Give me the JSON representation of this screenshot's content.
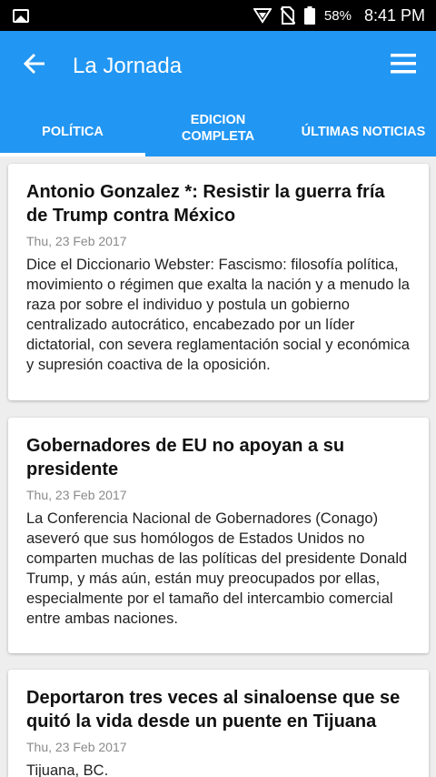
{
  "status_bar": {
    "battery_percent": "58%",
    "time": "8:41 PM"
  },
  "app_bar": {
    "title": "La Jornada",
    "back_icon": "arrow-left-icon",
    "menu_icon": "hamburger-menu-icon"
  },
  "tabs": [
    {
      "line1": "POLÍTICA",
      "line2": ""
    },
    {
      "line1": "EDICION",
      "line2": "COMPLETA"
    },
    {
      "line1": "ÚLTIMAS NOTICIAS",
      "line2": ""
    }
  ],
  "articles": [
    {
      "title": "Antonio Gonzalez *: Resistir la guerra fría de Trump contra México",
      "date": "Thu, 23 Feb 2017",
      "body": "Dice el Diccionario  Webster: Fascismo: filosofía política, movimiento o régimen que exalta la nación y a menudo la raza por sobre el individuo y postula un gobierno centralizado autocrático, encabezado por un líder dictatorial, con severa reglamentación social y económica y supresión coactiva de la oposición."
    },
    {
      "title": "Gobernadores de EU no apoyan a su presidente",
      "date": "Thu, 23 Feb 2017",
      "body": "La Conferencia Nacional de Gobernadores (Conago) aseveró que sus homólogos de Estados Unidos no comparten muchas de las políticas del presidente Donald Trump, y más aún, están muy preocupados por ellas, especialmente por el tamaño del intercambio comercial entre ambas naciones."
    },
    {
      "title": "Deportaron tres veces al sinaloense que se quitó la vida desde un puente en Tijuana",
      "date": "Thu, 23 Feb 2017",
      "body": "Tijuana, BC."
    }
  ],
  "colors": {
    "primary": "#2196f3",
    "background": "#eeeeee",
    "date_text": "#8a8a8a"
  }
}
